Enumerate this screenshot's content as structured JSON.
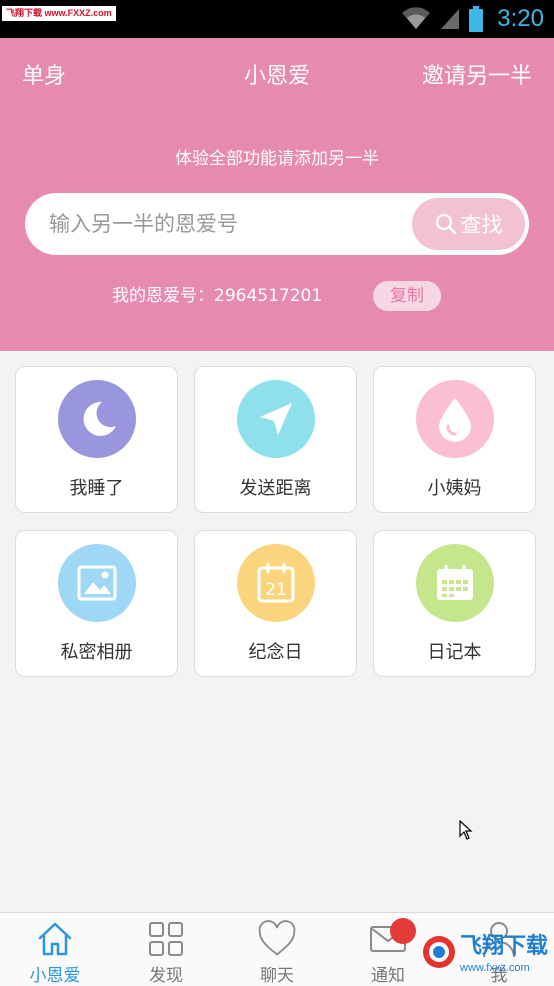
{
  "status_bar": {
    "time": "3:20",
    "watermark": "飞翔下载 www.FXXZ.com"
  },
  "header": {
    "left": "单身",
    "title": "小恩爱",
    "right": "邀请另一半",
    "hint": "体验全部功能请添加另一半",
    "search": {
      "placeholder": "输入另一半的恩爱号",
      "button": "查找"
    },
    "my_id_label": "我的恩爱号：2964517201",
    "copy": "复制"
  },
  "features": [
    {
      "label": "我睡了",
      "icon": "moon-icon",
      "color": "#9a96de"
    },
    {
      "label": "发送距离",
      "icon": "send-icon",
      "color": "#8ee1ea"
    },
    {
      "label": "小姨妈",
      "icon": "drop-icon",
      "color": "#fbbfd2"
    },
    {
      "label": "私密相册",
      "icon": "image-icon",
      "color": "#9fd8f5"
    },
    {
      "label": "纪念日",
      "icon": "calendar-icon",
      "color": "#fbd57e"
    },
    {
      "label": "日记本",
      "icon": "notebook-icon",
      "color": "#c6e68e"
    }
  ],
  "calendar_day": "21",
  "tabs": [
    {
      "label": "小恩爱",
      "icon": "home-icon",
      "active": true
    },
    {
      "label": "发现",
      "icon": "grid-icon"
    },
    {
      "label": "聊天",
      "icon": "heart-icon"
    },
    {
      "label": "通知",
      "icon": "mail-icon"
    },
    {
      "label": "我",
      "icon": "user-icon"
    }
  ],
  "watermark_br": {
    "text": "飞翔下载",
    "url": "www.fxxz.com"
  }
}
